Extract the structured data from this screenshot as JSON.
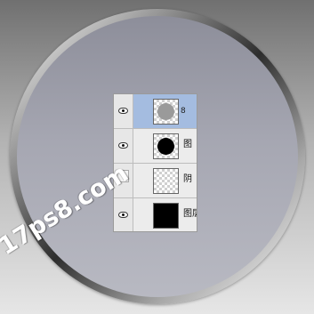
{
  "layers_panel": {
    "layers": [
      {
        "name": "",
        "thumbnail": "gray-circle",
        "visible": true,
        "selected": true,
        "linked": true
      },
      {
        "name": "图",
        "thumbnail": "black-circle",
        "visible": true,
        "selected": false,
        "linked": false
      },
      {
        "name": "阴",
        "thumbnail": "transparent",
        "visible": false,
        "selected": false,
        "linked": false
      },
      {
        "name": "图层",
        "thumbnail": "black-fill",
        "visible": true,
        "selected": false,
        "linked": false
      }
    ],
    "link_symbol": "8"
  },
  "watermark": {
    "text": "17ps8.com"
  },
  "colors": {
    "selection": "#a4bce0",
    "circle_fill": "#a6a7b2",
    "panel_bg": "#ececec"
  }
}
